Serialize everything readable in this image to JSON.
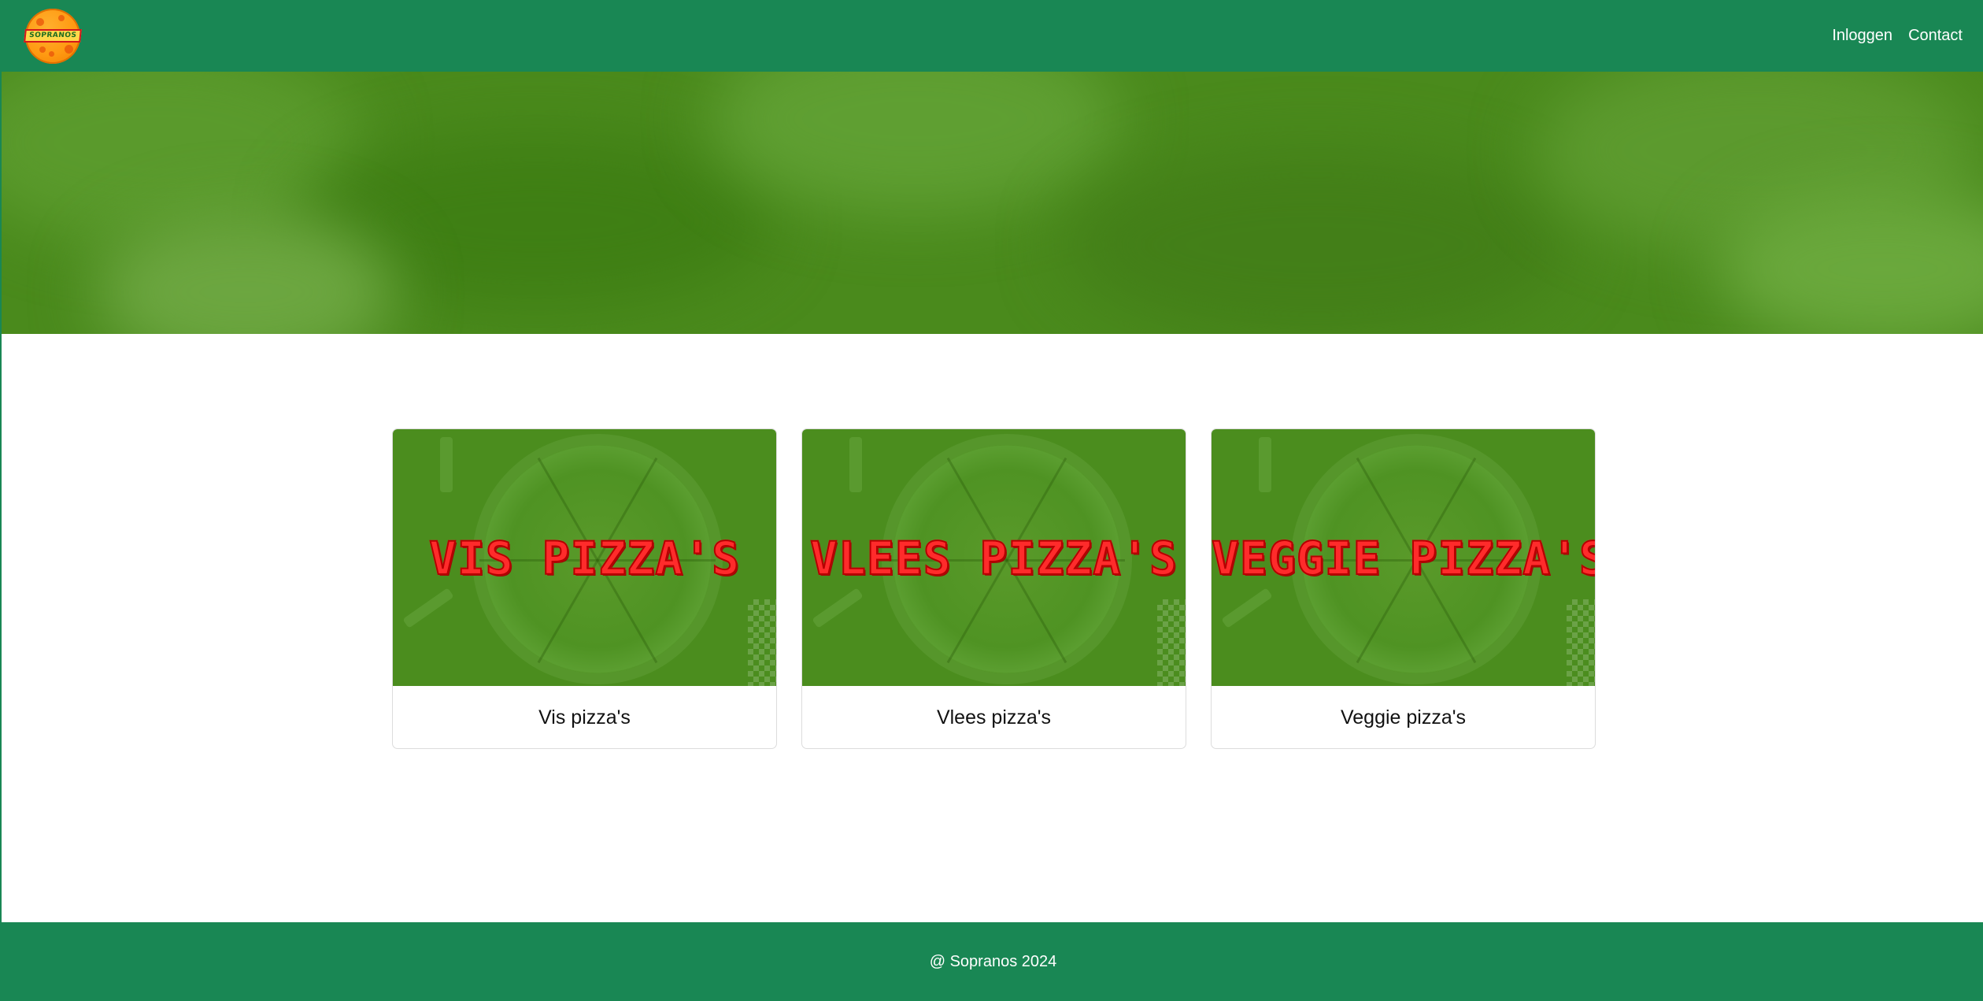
{
  "brand": {
    "logo_text": "SOPRANOS",
    "colors": {
      "primary": "#198754",
      "logo_orange": "#ff9a12",
      "logo_red": "#d4151c"
    }
  },
  "nav": {
    "links": [
      {
        "label": "Inloggen"
      },
      {
        "label": "Contact"
      }
    ]
  },
  "categories": [
    {
      "image_text": "VIS PIZZA'S",
      "title": "Vis pizza's"
    },
    {
      "image_text": "VLEES PIZZA'S",
      "title": "Vlees pizza's"
    },
    {
      "image_text": "VEGGIE PIZZA'S",
      "title": "Veggie pizza's"
    }
  ],
  "footer": {
    "text": "@ Sopranos 2024"
  }
}
